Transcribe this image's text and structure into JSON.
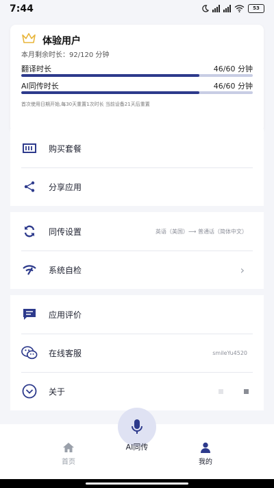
{
  "status": {
    "time": "7:44",
    "battery": "53"
  },
  "membership": {
    "title": "体验用户",
    "remaining": "本月剩余时长：92/120 分钟",
    "quotas": [
      {
        "label": "翻译时长",
        "value": "46/60 分钟",
        "progress": 0.77
      },
      {
        "label": "AI同传时长",
        "value": "46/60 分钟",
        "progress": 0.77
      }
    ],
    "note": "首次使用日期开始,每30天重置1次时长 当前设备21天后重置"
  },
  "menu": {
    "buy": "购买套餐",
    "share": "分享应用",
    "interp_settings": "同传设置",
    "lang_pair": "英语（美国）⟶ 普通话（简体中文）",
    "self_check": "系统自检",
    "rate": "应用评价",
    "support": "在线客服",
    "support_id": "smileYu4520",
    "about": "关于"
  },
  "nav": {
    "home": "首页",
    "ai": "AI同传",
    "mine": "我的"
  },
  "colors": {
    "accent": "#2d3a8c",
    "track": "#c8cde4",
    "crown": "#e8b53a"
  }
}
